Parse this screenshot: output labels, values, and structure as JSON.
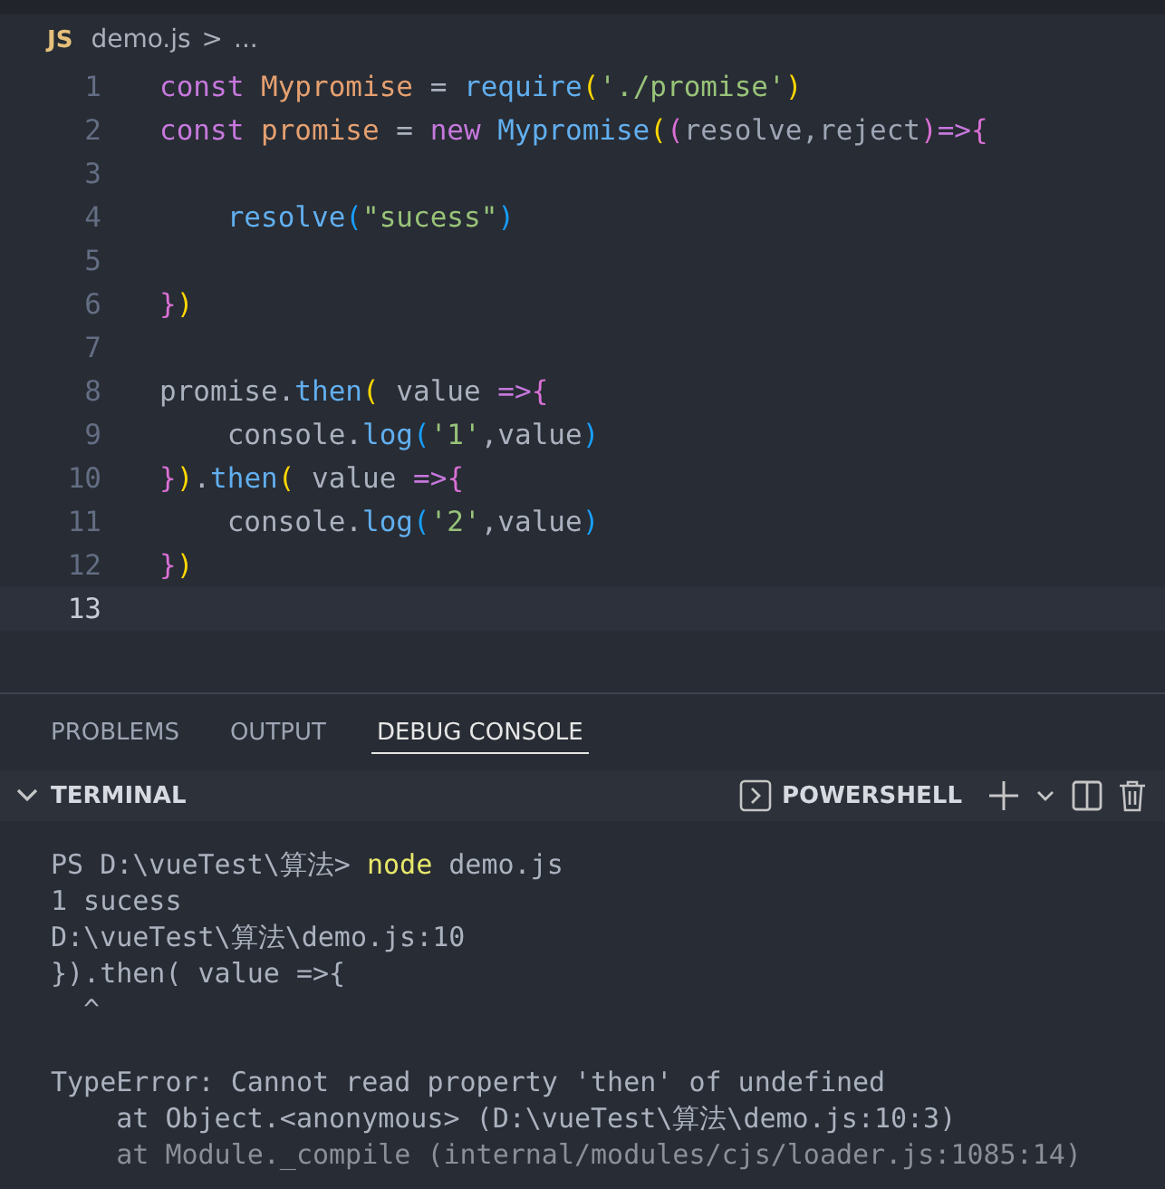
{
  "breadcrumb": {
    "file_icon": "JS",
    "file": "demo.js",
    "separator": ">",
    "trail": "..."
  },
  "editor": {
    "lines": [
      {
        "number": "1",
        "current": false,
        "tokens": [
          {
            "kind": "kw",
            "text": "const "
          },
          {
            "kind": "var",
            "text": "Mypromise"
          },
          {
            "kind": "plain",
            "text": " = "
          },
          {
            "kind": "fn",
            "text": "require"
          },
          {
            "kind": "br1",
            "text": "("
          },
          {
            "kind": "str",
            "text": "'./promise'"
          },
          {
            "kind": "br1",
            "text": ")"
          }
        ]
      },
      {
        "number": "2",
        "current": false,
        "tokens": [
          {
            "kind": "kw",
            "text": "const "
          },
          {
            "kind": "var",
            "text": "promise"
          },
          {
            "kind": "plain",
            "text": " = "
          },
          {
            "kind": "kw",
            "text": "new "
          },
          {
            "kind": "fn",
            "text": "Mypromise"
          },
          {
            "kind": "br1",
            "text": "("
          },
          {
            "kind": "br2",
            "text": "("
          },
          {
            "kind": "param",
            "text": "resolve,reject"
          },
          {
            "kind": "br2",
            "text": ")"
          },
          {
            "kind": "kw",
            "text": "=>"
          },
          {
            "kind": "br2",
            "text": "{"
          }
        ]
      },
      {
        "number": "3",
        "current": false
      },
      {
        "number": "4",
        "current": false,
        "tokens": [
          {
            "kind": "fn",
            "text": "    resolve"
          },
          {
            "kind": "br3",
            "text": "("
          },
          {
            "kind": "str",
            "text": "\"sucess\""
          },
          {
            "kind": "br3",
            "text": ")"
          }
        ]
      },
      {
        "number": "5",
        "current": false
      },
      {
        "number": "6",
        "current": false,
        "tokens": [
          {
            "kind": "br2",
            "text": "}"
          },
          {
            "kind": "br1",
            "text": ")"
          }
        ]
      },
      {
        "number": "7",
        "current": false
      },
      {
        "number": "8",
        "current": false,
        "tokens": [
          {
            "kind": "plain",
            "text": "promise."
          },
          {
            "kind": "fn",
            "text": "then"
          },
          {
            "kind": "br1",
            "text": "("
          },
          {
            "kind": "plain",
            "text": " value "
          },
          {
            "kind": "kw",
            "text": "=>"
          },
          {
            "kind": "br2",
            "text": "{"
          }
        ]
      },
      {
        "number": "9",
        "current": false,
        "tokens": [
          {
            "kind": "plain",
            "text": "    console."
          },
          {
            "kind": "fn",
            "text": "log"
          },
          {
            "kind": "br3",
            "text": "("
          },
          {
            "kind": "str",
            "text": "'1'"
          },
          {
            "kind": "plain",
            "text": ",value"
          },
          {
            "kind": "br3",
            "text": ")"
          }
        ]
      },
      {
        "number": "10",
        "current": false,
        "tokens": [
          {
            "kind": "br2",
            "text": "}"
          },
          {
            "kind": "br1",
            "text": ")"
          },
          {
            "kind": "plain",
            "text": "."
          },
          {
            "kind": "fn",
            "text": "then"
          },
          {
            "kind": "br1",
            "text": "("
          },
          {
            "kind": "plain",
            "text": " value "
          },
          {
            "kind": "kw",
            "text": "=>"
          },
          {
            "kind": "br2",
            "text": "{"
          }
        ]
      },
      {
        "number": "11",
        "current": false,
        "tokens": [
          {
            "kind": "plain",
            "text": "    console."
          },
          {
            "kind": "fn",
            "text": "log"
          },
          {
            "kind": "br3",
            "text": "("
          },
          {
            "kind": "str",
            "text": "'2'"
          },
          {
            "kind": "plain",
            "text": ",value"
          },
          {
            "kind": "br3",
            "text": ")"
          }
        ]
      },
      {
        "number": "12",
        "current": false,
        "tokens": [
          {
            "kind": "br2",
            "text": "}"
          },
          {
            "kind": "br1",
            "text": ")"
          }
        ]
      },
      {
        "number": "13",
        "current": true
      }
    ]
  },
  "panel_tabs": [
    {
      "label": "PROBLEMS",
      "selected": false
    },
    {
      "label": "OUTPUT",
      "selected": false
    },
    {
      "label": "DEBUG CONSOLE",
      "selected": true
    }
  ],
  "terminal": {
    "title": "TERMINAL",
    "expanded": true,
    "shell": "POWERSHELL",
    "lines": [
      {
        "tokens": [
          {
            "kind": "plain",
            "text": "PS D:\\vueTest\\算法> "
          },
          {
            "kind": "cmd",
            "text": "node"
          },
          {
            "kind": "plain",
            "text": " demo.js"
          }
        ]
      },
      {
        "tokens": [
          {
            "kind": "plain",
            "text": "1 sucess"
          }
        ]
      },
      {
        "tokens": [
          {
            "kind": "plain",
            "text": "D:\\vueTest\\算法\\demo.js:10"
          }
        ]
      },
      {
        "tokens": [
          {
            "kind": "plain",
            "text": "}).then( value =>{"
          }
        ]
      },
      {
        "tokens": [
          {
            "kind": "plain",
            "text": "  ^"
          }
        ]
      },
      {
        "gap_before": true,
        "tokens": [
          {
            "kind": "plain",
            "text": "TypeError: Cannot read property 'then' of undefined"
          }
        ]
      },
      {
        "tokens": [
          {
            "kind": "plain",
            "text": "    at Object.<anonymous> (D:\\vueTest\\算法\\demo.js:10:3)"
          }
        ]
      },
      {
        "tokens": [
          {
            "kind": "dim",
            "text": "    at Module._compile (internal/modules/cjs/loader.js:1085:14)"
          }
        ]
      }
    ]
  }
}
